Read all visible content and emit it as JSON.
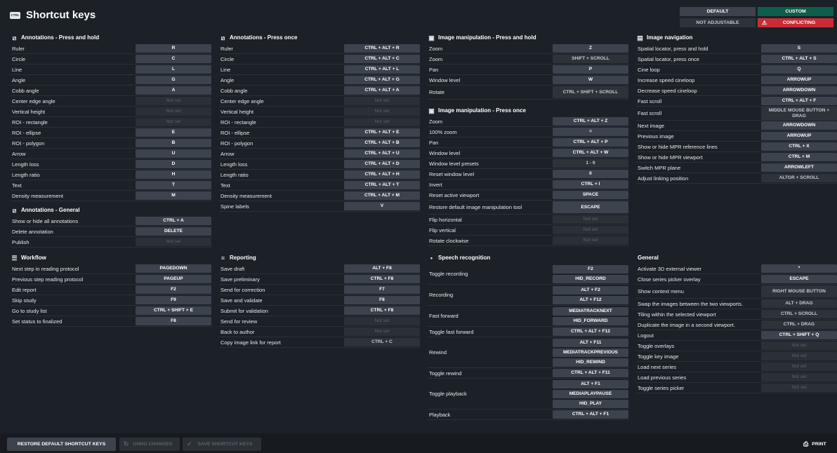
{
  "title": "Shortcut keys",
  "title_icon_text": "CTRL",
  "legend": {
    "default": "DEFAULT",
    "custom": "CUSTOM",
    "not_adjustable": "NOT ADJUSTABLE",
    "conflicting": "CONFLICTING",
    "conflicting_icon": "warning-icon"
  },
  "colors": {
    "background": "#1c2128",
    "key_default": "#3c434c",
    "key_not_adjustable": "#2e3339",
    "custom": "#0d5e4a",
    "conflicting": "#c82d37"
  },
  "sections": [
    {
      "key": "ann_hold",
      "title": "Annotations - Press and hold",
      "icon": "annotation-icon",
      "rows": [
        {
          "label": "Ruler",
          "keys": [
            "R"
          ]
        },
        {
          "label": "Circle",
          "keys": [
            "C"
          ]
        },
        {
          "label": "Line",
          "keys": [
            "L"
          ]
        },
        {
          "label": "Angle",
          "keys": [
            "G"
          ]
        },
        {
          "label": "Cobb angle",
          "keys": [
            "A"
          ]
        },
        {
          "label": "Center edge angle",
          "keys": [
            "Not set"
          ],
          "state": "notset"
        },
        {
          "label": "Vertical height",
          "keys": [
            "Not set"
          ],
          "state": "notset"
        },
        {
          "label": "ROI - rectangle",
          "keys": [
            "Not set"
          ],
          "state": "notset"
        },
        {
          "label": "ROI - ellipse",
          "keys": [
            "E"
          ]
        },
        {
          "label": "ROI - polygon",
          "keys": [
            "B"
          ]
        },
        {
          "label": "Arrow",
          "keys": [
            "U"
          ]
        },
        {
          "label": "Length loss",
          "keys": [
            "D"
          ]
        },
        {
          "label": "Length ratio",
          "keys": [
            "H"
          ]
        },
        {
          "label": "Text",
          "keys": [
            "T"
          ]
        },
        {
          "label": "Density measurement",
          "keys": [
            "M"
          ]
        }
      ]
    },
    {
      "key": "ann_general",
      "title": "Annotations - General",
      "icon": "annotation-icon",
      "rows": [
        {
          "label": "Show or hide all annotations",
          "keys": [
            "CTRL + A"
          ]
        },
        {
          "label": "Delete annotation",
          "keys": [
            "DELETE"
          ]
        },
        {
          "label": "Publish",
          "keys": [
            "Not set"
          ],
          "state": "notset"
        }
      ]
    },
    {
      "key": "workflow",
      "title": "Workflow",
      "icon": "list-icon",
      "rows": [
        {
          "label": "Next step in reading protocol",
          "keys": [
            "PAGEDOWN"
          ]
        },
        {
          "label": "Previous step reading protocol",
          "keys": [
            "PAGEUP"
          ]
        },
        {
          "label": "Edit report",
          "keys": [
            "F2"
          ]
        },
        {
          "label": "Skip study",
          "keys": [
            "F9"
          ]
        },
        {
          "label": "Go to study list",
          "keys": [
            "CTRL + SHIFT + E"
          ]
        },
        {
          "label": "Set status to finalized",
          "keys": [
            "F8"
          ]
        }
      ]
    },
    {
      "key": "ann_once",
      "title": "Annotations - Press once",
      "icon": "annotation-icon",
      "rows": [
        {
          "label": "Ruler",
          "keys": [
            "CTRL + ALT + R"
          ]
        },
        {
          "label": "Circle",
          "keys": [
            "CTRL + ALT + C"
          ]
        },
        {
          "label": "Line",
          "keys": [
            "CTRL + ALT + L"
          ]
        },
        {
          "label": "Angle",
          "keys": [
            "CTRL + ALT + G"
          ]
        },
        {
          "label": "Cobb angle",
          "keys": [
            "CTRL + ALT + A"
          ]
        },
        {
          "label": "Center edge angle",
          "keys": [
            "Not set"
          ],
          "state": "notset"
        },
        {
          "label": "Vertical height",
          "keys": [
            "Not set"
          ],
          "state": "notset"
        },
        {
          "label": "ROI - rectangle",
          "keys": [
            "Not set"
          ],
          "state": "notset"
        },
        {
          "label": "ROI - ellipse",
          "keys": [
            "CTRL + ALT + E"
          ]
        },
        {
          "label": "ROI - polygon",
          "keys": [
            "CTRL + ALT + B"
          ]
        },
        {
          "label": "Arrow",
          "keys": [
            "CTRL + ALT + U"
          ]
        },
        {
          "label": "Length loss",
          "keys": [
            "CTRL + ALT + D"
          ]
        },
        {
          "label": "Length ratio",
          "keys": [
            "CTRL + ALT + H"
          ]
        },
        {
          "label": "Text",
          "keys": [
            "CTRL + ALT + T"
          ]
        },
        {
          "label": "Density measurement",
          "keys": [
            "CTRL + ALT + M"
          ]
        },
        {
          "label": "Spine labels",
          "keys": [
            "V"
          ]
        }
      ]
    },
    {
      "key": "reporting",
      "title": "Reporting",
      "icon": "report-icon",
      "rows": [
        {
          "label": "Save draft",
          "keys": [
            "ALT + F8"
          ]
        },
        {
          "label": "Save preliminary",
          "keys": [
            "CTRL + F8"
          ]
        },
        {
          "label": "Send for correction",
          "keys": [
            "F7"
          ]
        },
        {
          "label": "Save and validate",
          "keys": [
            "F8"
          ]
        },
        {
          "label": "Submit for validation",
          "keys": [
            "CTRL + F8"
          ]
        },
        {
          "label": "Send for review",
          "keys": [
            "Not set"
          ],
          "state": "notset"
        },
        {
          "label": "Back to author",
          "keys": [
            "Not set"
          ],
          "state": "notset"
        },
        {
          "label": "Copy image link for report",
          "keys": [
            "CTRL + C"
          ],
          "state": "adj"
        }
      ]
    },
    {
      "key": "img_hold",
      "title": "Image manipulation - Press and hold",
      "icon": "image-manipulation-icon",
      "rows": [
        {
          "label": "Zoom",
          "keys": [
            "Z"
          ]
        },
        {
          "label": "Zoom",
          "keys": [
            "SHIFT + SCROLL"
          ],
          "state": "adj"
        },
        {
          "label": "Pan",
          "keys": [
            "P"
          ]
        },
        {
          "label": "Window level",
          "keys": [
            "W"
          ]
        },
        {
          "label": "Rotate",
          "keys": [
            "CTRL + SHIFT + SCROLL"
          ],
          "state": "adj",
          "tall": true
        }
      ]
    },
    {
      "key": "img_once",
      "title": "Image manipulation - Press once",
      "icon": "image-manipulation-icon",
      "rows": [
        {
          "label": "Zoom",
          "keys": [
            "CTRL + ALT + Z"
          ]
        },
        {
          "label": "100% zoom",
          "keys": [
            "="
          ]
        },
        {
          "label": "Pan",
          "keys": [
            "CTRL + ALT + P"
          ]
        },
        {
          "label": "Window level",
          "keys": [
            "CTRL + ALT + W"
          ]
        },
        {
          "label": "Window level presets",
          "keys": [
            "1 - 9"
          ],
          "state": "adj"
        },
        {
          "label": "Reset window level",
          "keys": [
            "0"
          ]
        },
        {
          "label": "Invert",
          "keys": [
            "CTRL + I"
          ]
        },
        {
          "label": "Reset active viewport",
          "keys": [
            "SPACE"
          ]
        },
        {
          "label": "Restore default image manipulation tool",
          "keys": [
            "ESCAPE"
          ],
          "tall": true
        },
        {
          "label": "Flip horizontal",
          "keys": [
            "Not set"
          ],
          "state": "notset"
        },
        {
          "label": "Flip vertical",
          "keys": [
            "Not set"
          ],
          "state": "notset"
        },
        {
          "label": "Rotate clockwise",
          "keys": [
            "Not set"
          ],
          "state": "notset"
        }
      ]
    },
    {
      "key": "speech",
      "title": "Speech recognition",
      "icon": "microphone-icon",
      "rows": [
        {
          "label": "Toggle recording",
          "keys": [
            "F2",
            "HID_RECORD"
          ]
        },
        {
          "label": "Recording",
          "keys": [
            "ALT + F2",
            "ALT + F12"
          ]
        },
        {
          "label": "Fast forward",
          "keys": [
            "MEDIATRACKNEXT",
            "HID_FORWARD"
          ]
        },
        {
          "label": "Toggle fast forward",
          "keys": [
            "CTRL + ALT + F12"
          ]
        },
        {
          "label": "Rewind",
          "keys": [
            "ALT + F11",
            "MEDIATRACKPREVIOUS",
            "HID_REWIND"
          ]
        },
        {
          "label": "Toggle rewind",
          "keys": [
            "CTRL + ALT + F11"
          ]
        },
        {
          "label": "Toggle playback",
          "keys": [
            "ALT + F1",
            "MEDIAPLAYPAUSE",
            "HID_PLAY"
          ]
        },
        {
          "label": "Playback",
          "keys": [
            "CTRL + ALT + F1"
          ]
        }
      ]
    },
    {
      "key": "nav",
      "title": "Image navigation",
      "icon": "image-navigation-icon",
      "rows": [
        {
          "label": "Spatial locator, press and hold",
          "keys": [
            "S"
          ]
        },
        {
          "label": "Spatial locator, press once",
          "keys": [
            "CTRL + ALT + S"
          ]
        },
        {
          "label": "Cine loop",
          "keys": [
            "Q"
          ]
        },
        {
          "label": "Increase speed cineloop",
          "keys": [
            "ARROWUP"
          ]
        },
        {
          "label": "Decrease speed cineloop",
          "keys": [
            "ARROWDOWN"
          ]
        },
        {
          "label": "Fast scroll",
          "keys": [
            "CTRL + ALT + F"
          ]
        },
        {
          "label": "Fast scroll",
          "keys": [
            "MIDDLE MOUSE BUTTON + DRAG"
          ],
          "state": "adj",
          "tall": true
        },
        {
          "label": "Next image",
          "keys": [
            "ARROWDOWN"
          ]
        },
        {
          "label": "Previous image",
          "keys": [
            "ARROWUP"
          ]
        },
        {
          "label": "Show or hide MPR reference lines",
          "keys": [
            "CTRL + X"
          ]
        },
        {
          "label": "Show or hide MPR viewport",
          "keys": [
            "CTRL + M"
          ]
        },
        {
          "label": "Switch MPR plane",
          "keys": [
            "ARROWLEFT"
          ]
        },
        {
          "label": "Adjust linking position",
          "keys": [
            "ALTGR + SCROLL"
          ],
          "state": "adj"
        }
      ]
    },
    {
      "key": "general",
      "title": "General",
      "icon": "",
      "rows": [
        {
          "label": "Activate 3D external viewer",
          "keys": [
            "*"
          ]
        },
        {
          "label": "Close series picker overlay",
          "keys": [
            "ESCAPE"
          ]
        },
        {
          "label": "Show context menu",
          "keys": [
            "RIGHT MOUSE BUTTON"
          ],
          "state": "adj",
          "tall": true
        },
        {
          "label": "Swap the images between the two viewports.",
          "keys": [
            "ALT + DRAG"
          ],
          "state": "adj"
        },
        {
          "label": "Tiling within the selected viewport",
          "keys": [
            "CTRL + SCROLL"
          ],
          "state": "adj"
        },
        {
          "label": "Duplicate the image in a second viewport.",
          "keys": [
            "CTRL + DRAG"
          ],
          "state": "adj"
        },
        {
          "label": "Logout",
          "keys": [
            "CTRL + SHIFT + Q"
          ]
        },
        {
          "label": "Toggle overlays",
          "keys": [
            "Not set"
          ],
          "state": "notset"
        },
        {
          "label": "Toggle key image",
          "keys": [
            "Not set"
          ],
          "state": "notset"
        },
        {
          "label": "Load next series",
          "keys": [
            "Not set"
          ],
          "state": "notset"
        },
        {
          "label": "Load previous series",
          "keys": [
            "Not set"
          ],
          "state": "notset"
        },
        {
          "label": "Toggle series picker",
          "keys": [
            "Not set"
          ],
          "state": "notset"
        }
      ]
    }
  ],
  "footer": {
    "restore": "RESTORE DEFAULT SHORTCUT KEYS",
    "undo": "UNDO CHANGES",
    "save": "SAVE SHORTCUT KEYS",
    "print": "PRINT"
  }
}
